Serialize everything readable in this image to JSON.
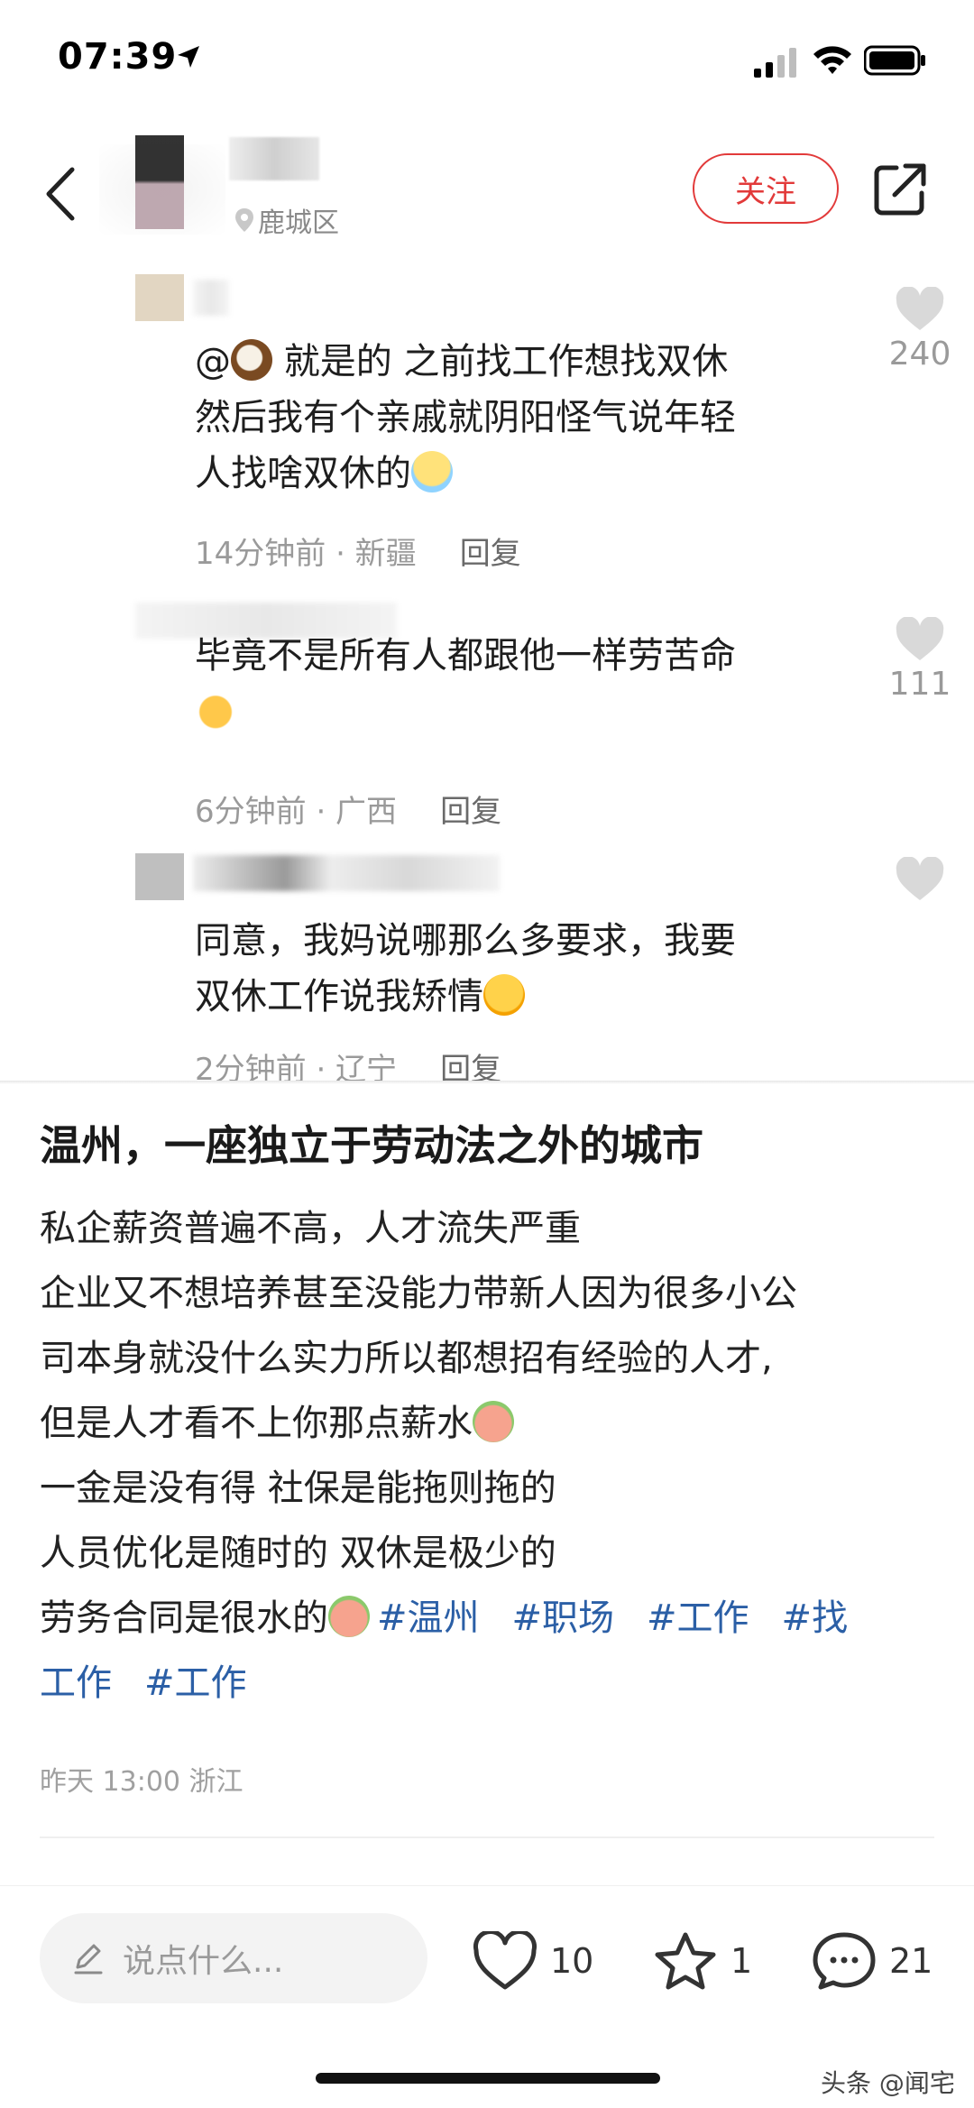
{
  "status_bar": {
    "time": "07:39"
  },
  "header": {
    "location": "鹿城区",
    "follow_label": "关注"
  },
  "comments": [
    {
      "mention": "@",
      "lines": [
        "就是的 之前找工作想找双休",
        "然后我有个亲戚就阴阳怪气说年轻",
        "人找啥双休的"
      ],
      "time_location": "14分钟前 · 新疆",
      "reply_label": "回复",
      "likes": "240"
    },
    {
      "lines": [
        "毕竟不是所有人都跟他一样劳苦命"
      ],
      "time_location": "6分钟前 · 广西",
      "reply_label": "回复",
      "likes": "111"
    },
    {
      "lines": [
        "同意，我妈说哪那么多要求，我要",
        "双休工作说我矫情"
      ],
      "time_location": "2分钟前 · 辽宁",
      "reply_label": "回复",
      "likes": ""
    }
  ],
  "post": {
    "title": "温州，一座独立于劳动法之外的城市",
    "lines": [
      "私企薪资普遍不高，人才流失严重",
      "企业又不想培养甚至没能力带新人因为很多小公",
      "司本身就没什么实力所以都想招有经验的人才,",
      "但是人才看不上你那点薪水",
      "一金是没有得 社保是能拖则拖的",
      "人员优化是随时的 双休是极少的",
      "劳务合同是很水的"
    ],
    "hashtags": [
      "#温州",
      "#职场",
      "#工作",
      "#找"
    ],
    "hashtags_line2": [
      "工作",
      "#工作"
    ],
    "meta": "昨天 13:00 浙江"
  },
  "bottom_bar": {
    "input_placeholder": "说点什么...",
    "likes": "10",
    "favorites": "1",
    "comments": "21"
  },
  "watermark": "头条 @闻宅",
  "colors": {
    "accent_red": "#e23a3a",
    "hashtag_blue": "#2b5fa6"
  }
}
